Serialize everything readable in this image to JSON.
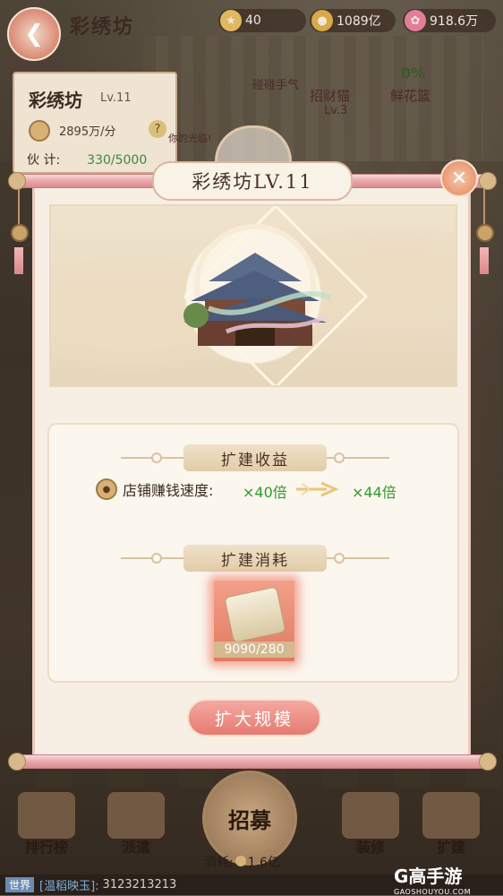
{
  "header": {
    "shop_name": "彩绣坊",
    "resources": [
      {
        "icon": "star-token-icon",
        "value": "40"
      },
      {
        "icon": "coin-icon",
        "value": "1089亿"
      },
      {
        "icon": "flower-icon",
        "value": "918.6万"
      }
    ]
  },
  "info_card": {
    "name": "彩绣坊",
    "level": "Lv.11",
    "income": "2895万/分",
    "helper_label": "伙  计:",
    "helper_progress": "330/5000"
  },
  "npcs": {
    "luck_label": "碰碰手气",
    "cat_name": "招财猫",
    "cat_level": "Lv.3",
    "flower_percent": "0%",
    "flower_basket": "鲜花篮",
    "bubble": "你的光临!"
  },
  "modal": {
    "title": "彩绣坊LV.11",
    "profit_header": "扩建收益",
    "speed_label": "店铺赚钱速度:",
    "multiplier_current": "×40倍",
    "multiplier_next": "×44倍",
    "cost_header": "扩建消耗",
    "cost_item_count": "9090/280",
    "expand_button": "扩大规模"
  },
  "bottom_nav": {
    "ranking": "排行榜",
    "dispatch": "派遣",
    "recruit": "招募",
    "decorate": "装修",
    "expand": "扩建",
    "cost_label": "消耗:",
    "cost_value": "1.6亿"
  },
  "chat": {
    "channel": "世界",
    "sender": "[温稻映玉]:",
    "message": "3123213213"
  },
  "watermark": {
    "brand": "G高手游",
    "url": "GAOSHOUYOU.COM"
  },
  "colors": {
    "accent_pink": "#e67b72",
    "green_multiplier": "#2f9a2f",
    "panel_bg": "#f7efe3"
  }
}
